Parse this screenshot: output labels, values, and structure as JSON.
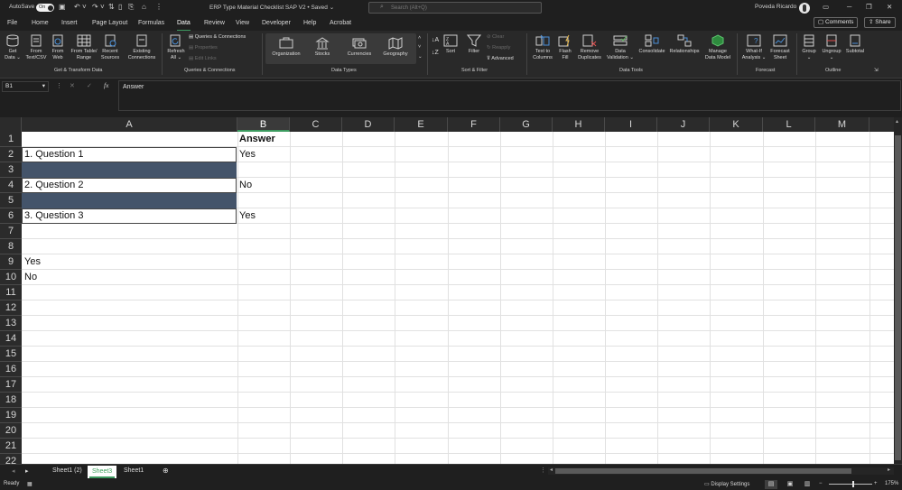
{
  "titlebar": {
    "autosave_label": "AutoSave",
    "autosave_state": "On",
    "document_title": "ERP Type Material Checklist SAP V2 • Saved ⌄",
    "search_placeholder": "Search (Alt+Q)",
    "user_name": "Poveda Ricardo"
  },
  "menu": {
    "tabs": [
      "File",
      "Home",
      "Insert",
      "Page Layout",
      "Formulas",
      "Data",
      "Review",
      "View",
      "Developer",
      "Help",
      "Acrobat"
    ],
    "active": "Data",
    "comments_label": "Comments",
    "share_label": "Share"
  },
  "ribbon": {
    "get_transform": {
      "get_data": "Get\nData ⌄",
      "from_text_csv": "From\nText/CSV",
      "from_web": "From\nWeb",
      "from_table_range": "From Table/\nRange",
      "recent_sources": "Recent\nSources",
      "existing_connections": "Existing\nConnections",
      "group_label": "Get & Transform Data"
    },
    "queries": {
      "refresh_all": "Refresh\nAll ⌄",
      "queries_connections": "Queries & Connections",
      "properties": "Properties",
      "edit_links": "Edit Links",
      "group_label": "Queries & Connections"
    },
    "data_types": {
      "organization": "Organization",
      "stocks": "Stocks",
      "currencies": "Currencies",
      "geography": "Geography",
      "group_label": "Data Types"
    },
    "sort_filter": {
      "sort": "Sort",
      "filter": "Filter",
      "clear": "Clear",
      "reapply": "Reapply",
      "advanced": "Advanced",
      "group_label": "Sort & Filter"
    },
    "data_tools": {
      "text_to_columns": "Text to\nColumns",
      "flash_fill": "Flash\nFill",
      "remove_duplicates": "Remove\nDuplicates",
      "data_validation": "Data\nValidation ⌄",
      "consolidate": "Consolidate",
      "relationships": "Relationships",
      "manage_data_model": "Manage\nData Model",
      "group_label": "Data Tools"
    },
    "forecast": {
      "what_if": "What-If\nAnalysis ⌄",
      "forecast_sheet": "Forecast\nSheet",
      "group_label": "Forecast"
    },
    "outline": {
      "group": "Group\n⌄",
      "ungroup": "Ungroup\n⌄",
      "subtotal": "Subtotal",
      "group_label": "Outline"
    }
  },
  "formula_bar": {
    "name_box": "B1",
    "formula": "Answer"
  },
  "grid": {
    "columns": [
      "A",
      "B",
      "C",
      "D",
      "E",
      "F",
      "G",
      "H",
      "I",
      "J",
      "K",
      "L",
      "M"
    ],
    "rows": [
      "1",
      "2",
      "3",
      "4",
      "5",
      "6",
      "7",
      "8",
      "9",
      "10",
      "11",
      "12",
      "13",
      "14",
      "15",
      "16",
      "17",
      "18",
      "19",
      "20",
      "21",
      "22"
    ],
    "selected_column": "B",
    "cells": {
      "B1": "Answer",
      "A2": "1. Question 1",
      "B2": "Yes",
      "A4": "2. Question 2",
      "B4": "No",
      "A6": "3. Question 3",
      "B6": "Yes",
      "A9": "Yes",
      "A10": "No"
    },
    "band_color": "#44546A"
  },
  "sheets": {
    "tabs": [
      "Sheet1 (2)",
      "Sheet3",
      "Sheet1"
    ],
    "active": "Sheet3"
  },
  "status": {
    "mode": "Ready",
    "display_settings": "Display Settings",
    "zoom": "175%"
  },
  "colors": {
    "accent": "#3C9A5F",
    "background": "#1F1F1F"
  }
}
